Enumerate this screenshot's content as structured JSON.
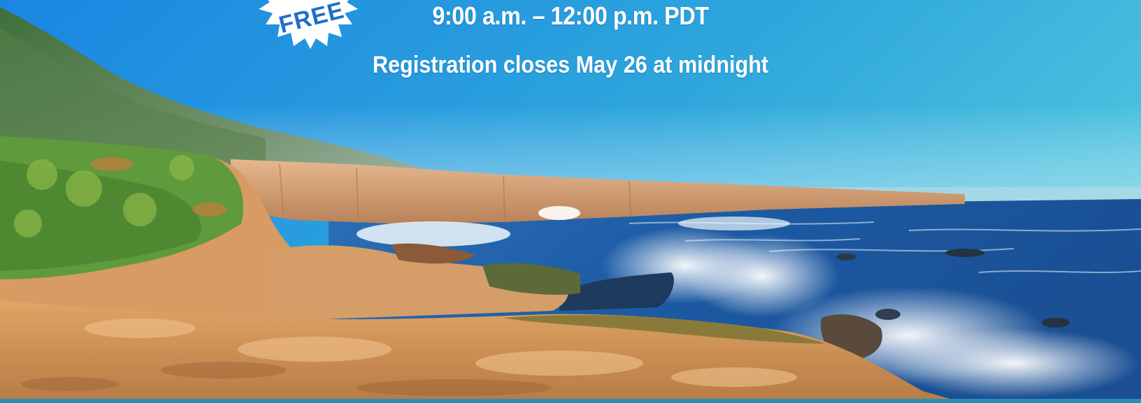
{
  "event": {
    "badge_text": "FREE",
    "time": "9:00 a.m. – 12:00 p.m. PDT",
    "registration": "Registration closes May 26 at midnight"
  },
  "colors": {
    "sky_top": "#1e8fe0",
    "sky_bottom": "#4fc0e0",
    "ocean": "#1d5fa8",
    "cliff": "#d9a070",
    "vegetation": "#5c9a3a",
    "badge_text": "#1f6fc4",
    "bottom_bar": "#2a8fb8"
  },
  "image": {
    "subject": "coastal-cliffs-and-ocean-waves"
  }
}
